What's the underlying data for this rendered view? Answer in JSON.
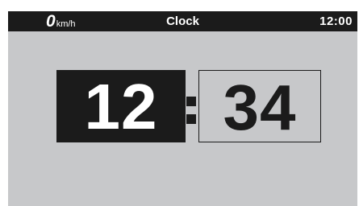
{
  "status_bar": {
    "speed_value": "0",
    "speed_unit": "km/h",
    "title": "Clock",
    "time": "12:00"
  },
  "clock": {
    "hours": "12",
    "minutes": "34",
    "separator": ":"
  },
  "colors": {
    "background": "#c7c8ca",
    "dark": "#1b1b1b",
    "light": "#ffffff"
  }
}
